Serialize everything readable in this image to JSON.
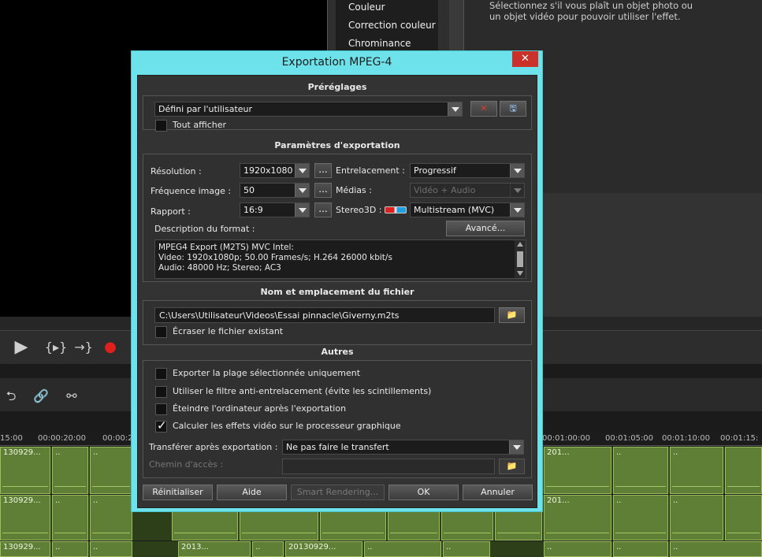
{
  "background": {
    "menu_items": [
      "Couleur",
      "Correction couleur",
      "Chrominance"
    ],
    "hint_line1": "Sélectionnez s'il vous plaît un objet photo ou",
    "hint_line2": "un objet vidéo pour pouvoir utiliser l'effet.",
    "ruler_labels": [
      "15:00",
      "00:00:20:00",
      "00:00:2",
      "00:01:00:00",
      "00:01:05:00",
      "00:01:10:00",
      "00:01:15:"
    ],
    "clip_labels": [
      "130929...",
      "..",
      "..",
      "..",
      "..",
      "201...",
      "2013...",
      "20130929..."
    ]
  },
  "dialog": {
    "title": "Exportation MPEG-4",
    "presets": {
      "section_title": "Préréglages",
      "preset_value": "Défini par l'utilisateur",
      "show_all_label": "Tout afficher"
    },
    "export_params": {
      "section_title": "Paramètres d'exportation",
      "resolution_label": "Résolution :",
      "resolution_value": "1920x1080",
      "framerate_label": "Fréquence image :",
      "framerate_value": "50",
      "ratio_label": "Rapport :",
      "ratio_value": "16:9",
      "interlace_label": "Entrelacement :",
      "interlace_value": "Progressif",
      "media_label": "Médias :",
      "media_value": "Vidéo + Audio",
      "stereo_label": "Stereo3D :",
      "stereo_value": "Multistream (MVC)",
      "format_desc_label": "Description du format :",
      "advanced_label": "Avancé...",
      "ellipsis": "...",
      "desc_line1": "MPEG4 Export (M2TS) MVC Intel:",
      "desc_line2": "Video: 1920x1080p; 50.00 Frames/s; H.264 26000 kbit/s",
      "desc_line3": "Audio: 48000 Hz; Stereo;  AC3"
    },
    "file": {
      "section_title": "Nom et emplacement du fichier",
      "path_value": "C:\\Users\\Utilisateur\\Videos\\Essai pinnacle\\Giverny.m2ts",
      "overwrite_label": "Écraser le fichier existant"
    },
    "other": {
      "section_title": "Autres",
      "opt_range": "Exporter la plage sélectionnée uniquement",
      "opt_deinterlace": "Utiliser le filtre anti-entrelacement (évite les scintillements)",
      "opt_shutdown": "Éteindre l'ordinateur après l'exportation",
      "opt_gpu": "Calculer les effets vidéo sur le processeur graphique",
      "transfer_label": "Transférer après exportation :",
      "transfer_value": "Ne pas faire le transfert",
      "path_label": "Chemin d'accès :"
    },
    "buttons": {
      "reset": "Réinitialiser",
      "help": "Aide",
      "smart": "Smart Rendering...",
      "ok": "OK",
      "cancel": "Annuler"
    }
  },
  "colors": {
    "dialog_border": "#6ee2ea",
    "close": "#c9312a",
    "clip": "#5f7f36"
  }
}
